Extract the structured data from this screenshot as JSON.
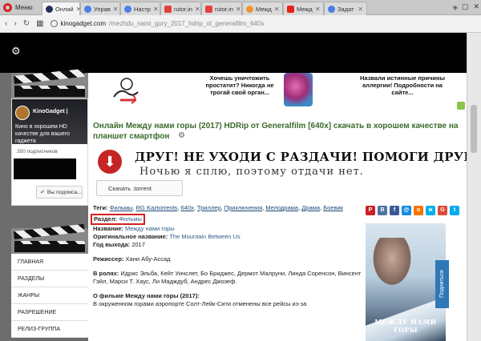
{
  "browser": {
    "menu_label": "Меню",
    "tabs": [
      {
        "label": "Онлай",
        "favicon": "kinogadget-icon",
        "active": true
      },
      {
        "label": "Управ",
        "favicon": "blue-u-icon"
      },
      {
        "label": "Настр",
        "favicon": "blue-u-icon"
      },
      {
        "label": "rutor.in",
        "favicon": "star-icon"
      },
      {
        "label": "rutor.in",
        "favicon": "star-icon"
      },
      {
        "label": "Межд",
        "favicon": "orange-icon"
      },
      {
        "label": "Межд",
        "favicon": "youtube-icon"
      },
      {
        "label": "Задат",
        "favicon": "blue-u-icon"
      }
    ],
    "url_domain": "kinogadget.com",
    "url_path": "/mezhdu_nami_gory_2017_hdrip_ot_generalfilm_640x"
  },
  "sidebar": {
    "channel_name": "KinoGadget |",
    "channel_desc": "Кино в хорошем HD качестве для вашего гаджета",
    "subscribers": "350 подписчиков",
    "subscribe_btn": "Вы подписа...",
    "menu": [
      "ГЛАВНАЯ",
      "РАЗДЕЛЫ",
      "ЖАНРЫ",
      "РАЗРЕШЕНИЕ",
      "РЕЛИЗ-ГРУППА"
    ]
  },
  "ads": {
    "ad1": "Хочешь уничтожить простатит? Никогда не трогай свой орган...",
    "ad2": "Назвали истинные причины аллергии! Подробности на сайте..."
  },
  "page": {
    "title": "Онлайн Между нами горы (2017) HDRip от Generalfilm [640x] скачать в хорошем качестве на планшет смартфон",
    "banner_line1": "ДРУГ! НЕ УХОДИ С РАЗДАЧИ! ПОМОГИ ДРУГИМ!",
    "banner_line2": "Ночью я сплю, поэтому отдачи нет.",
    "torrent_btn": "Скачать .torrent",
    "tags_label": "Теги:",
    "tags": [
      "Фильмы",
      "RG Kaztorrents",
      "640x",
      "Триллер",
      "Приключения",
      "Мелодрама",
      "Драма",
      "Боевик"
    ],
    "section_label": "Раздел:",
    "section_value": "Фильмы",
    "title_label": "Название:",
    "title_value": "Между нами горы",
    "orig_label": "Оригинальное название:",
    "orig_value": "The Mountain Between Us",
    "year_label": "Год выхода:",
    "year_value": "2017",
    "director_label": "Режиссер:",
    "director_value": "Хани Абу-Ассад",
    "cast_label": "В ролях:",
    "cast_value": "Идрис Эльба, Кейт Уинслет, Бо Бриджес, Дермот Малруни, Линда Соренсон, Винсент Гэйл, Марси Т. Хаус, Ли Мадждуб, Андрес Джозеф.",
    "about_label": "О фильме Между нами горы (2017):",
    "about_text": "В окруженном горами аэропорте Солт-Лейк-Сити отменены все рейсы из-за",
    "poster_title": "МЕЖДУ НАМИ ГОРЫ",
    "up_label": "Подняться"
  },
  "share": [
    {
      "name": "pinterest-share-icon",
      "glyph": "P",
      "color": "#cb2027"
    },
    {
      "name": "vk-share-icon",
      "glyph": "B",
      "color": "#4c75a3"
    },
    {
      "name": "facebook-share-icon",
      "glyph": "f",
      "color": "#3b5998"
    },
    {
      "name": "mailru-share-icon",
      "glyph": "@",
      "color": "#168de2"
    },
    {
      "name": "odnoklassniki-share-icon",
      "glyph": "o",
      "color": "#f97400"
    },
    {
      "name": "livejournal-share-icon",
      "glyph": "ж",
      "color": "#00b0ea"
    },
    {
      "name": "googleplus-share-icon",
      "glyph": "G",
      "color": "#dd4b39"
    },
    {
      "name": "twitter-share-icon",
      "glyph": "t",
      "color": "#00aced"
    }
  ]
}
